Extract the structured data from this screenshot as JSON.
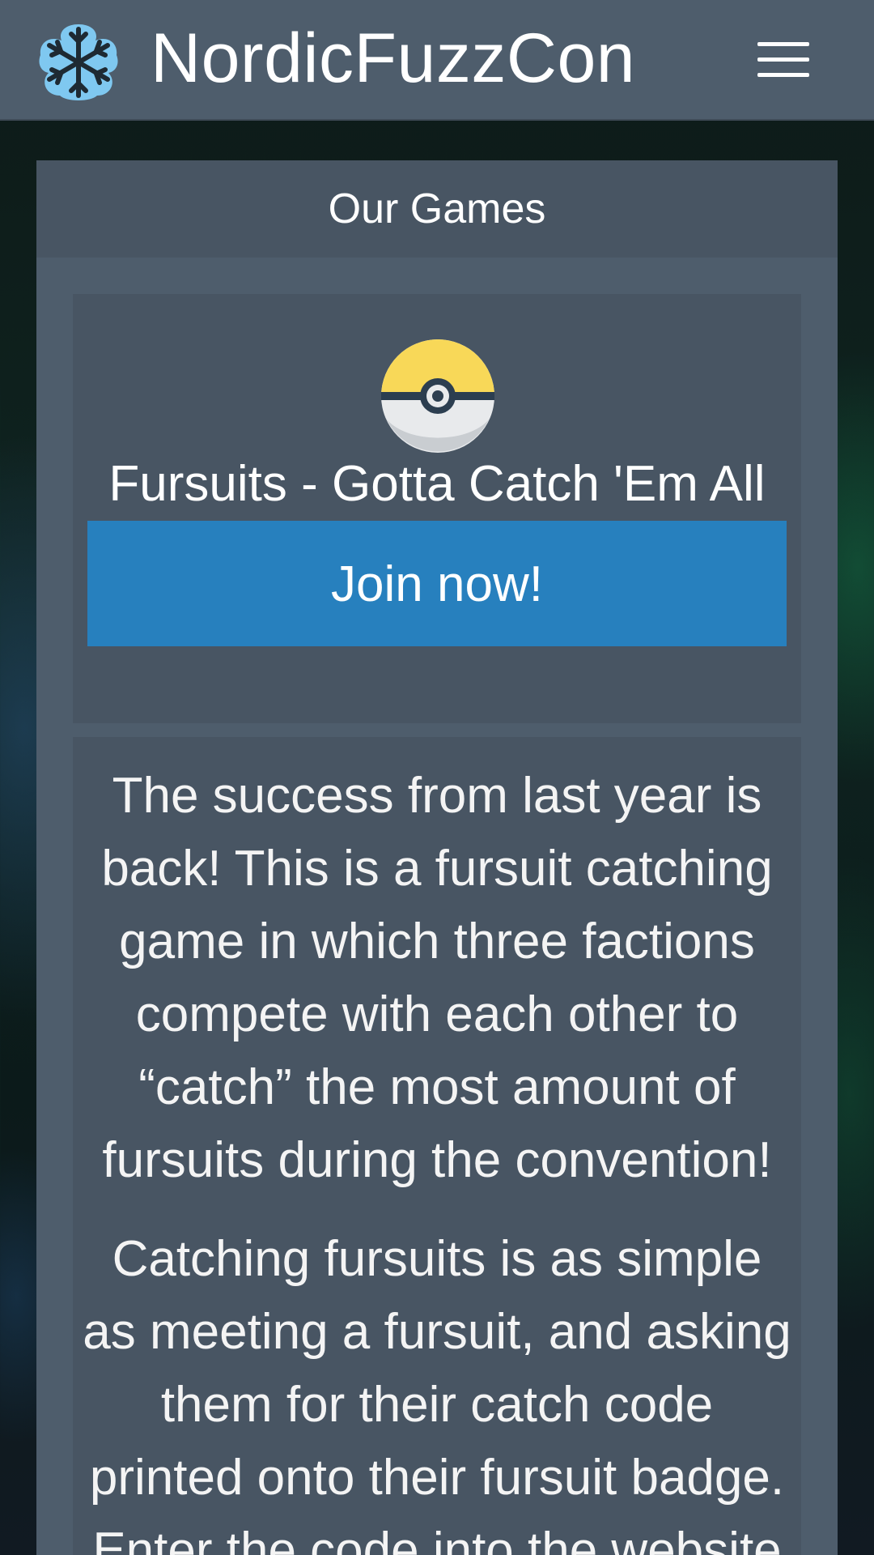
{
  "header": {
    "brand_name": "NordicFuzzCon",
    "logo_icon": "snowflake-icon",
    "menu_icon": "hamburger-menu-icon"
  },
  "card": {
    "title": "Our Games",
    "game": {
      "icon": "pokeball-icon",
      "title": "Fursuits - Gotta Catch 'Em All",
      "button_label": "Join now!"
    },
    "description": [
      "The success from last year is back! This is a fursuit catching game in which three factions compete with each other to “catch” the most amount of fursuits during the convention!",
      "Catching fursuits is as simple as meeting a fursuit, and asking them for their catch code printed onto their fursuit badge. Enter the code into the website"
    ]
  },
  "colors": {
    "navbar": "#4e5d6c",
    "card": "#4e5d6c",
    "panel": "#485563",
    "button": "#2780be",
    "logo": "#7fc8f0",
    "pokeball_top": "#f8d858",
    "pokeball_bottom": "#e8eaec"
  }
}
